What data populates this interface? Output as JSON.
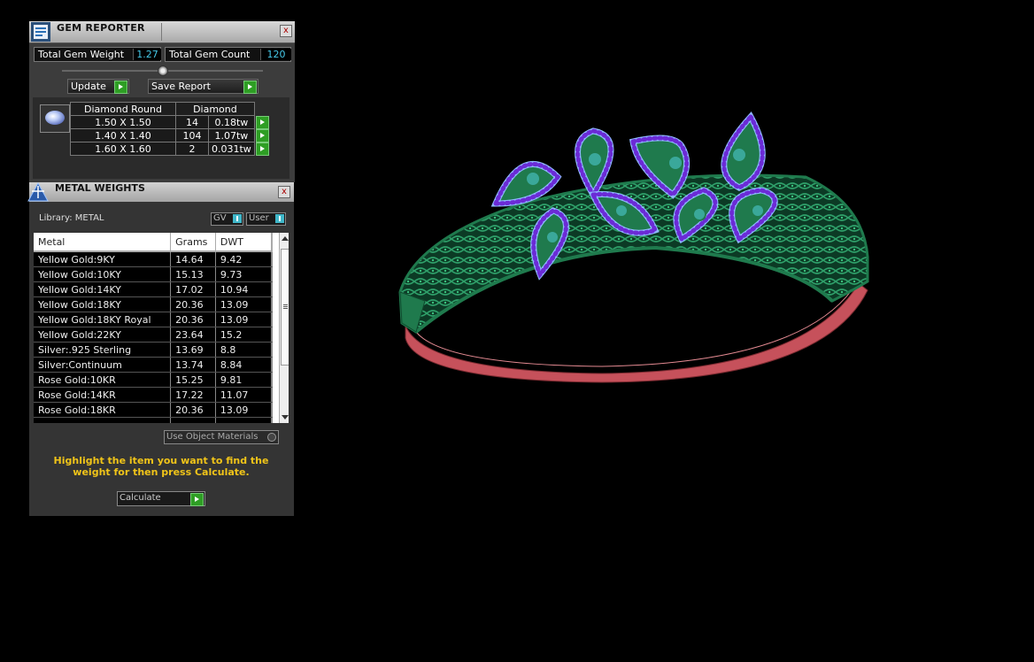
{
  "gem_reporter": {
    "title": "GEM REPORTER",
    "close_label": "x",
    "total_weight_label": "Total Gem Weight",
    "total_weight_value": "1.27",
    "total_count_label": "Total Gem Count",
    "total_count_value": "120",
    "update_label": "Update",
    "save_report_label": "Save Report",
    "table": {
      "headers": [
        "Diamond Round",
        "Diamond"
      ],
      "rows": [
        {
          "size": "1.50 X 1.50",
          "count": "14",
          "weight": "0.18tw"
        },
        {
          "size": "1.40 X 1.40",
          "count": "104",
          "weight": "1.07tw"
        },
        {
          "size": "1.60 X 1.60",
          "count": "2",
          "weight": "0.031tw"
        }
      ]
    }
  },
  "metal_weights": {
    "title": "METAL WEIGHTS",
    "close_label": "x",
    "library_label": "Library: METAL",
    "gv_label": "GV",
    "user_label": "User",
    "columns": [
      "Metal",
      "Grams",
      "DWT"
    ],
    "rows": [
      {
        "metal": "Yellow Gold:9KY",
        "grams": "14.64",
        "dwt": "9.42"
      },
      {
        "metal": "Yellow Gold:10KY",
        "grams": "15.13",
        "dwt": "9.73"
      },
      {
        "metal": "Yellow Gold:14KY",
        "grams": "17.02",
        "dwt": "10.94"
      },
      {
        "metal": "Yellow Gold:18KY",
        "grams": "20.36",
        "dwt": "13.09"
      },
      {
        "metal": "Yellow Gold:18KY Royal",
        "grams": "20.36",
        "dwt": "13.09"
      },
      {
        "metal": "Yellow Gold:22KY",
        "grams": "23.64",
        "dwt": "15.2"
      },
      {
        "metal": "Silver:.925 Sterling",
        "grams": "13.69",
        "dwt": "8.8"
      },
      {
        "metal": "Silver:Continuum",
        "grams": "13.74",
        "dwt": "8.84"
      },
      {
        "metal": "Rose Gold:10KR",
        "grams": "15.25",
        "dwt": "9.81"
      },
      {
        "metal": "Rose Gold:14KR",
        "grams": "17.22",
        "dwt": "11.07"
      },
      {
        "metal": "Rose Gold:18KR",
        "grams": "20.36",
        "dwt": "13.09"
      }
    ],
    "use_object_materials_label": "Use Object Materials",
    "hint": "Highlight the item you want to find the weight for then press Calculate.",
    "calculate_label": "Calculate"
  },
  "colors": {
    "metal_green": "#1f7a4d",
    "gem_blue": "#8fb8ff",
    "gem_purple": "#6b2bd6",
    "band_red": "#c6515b",
    "value_cyan": "#45c8e8",
    "hint_yellow": "#f0c419"
  }
}
